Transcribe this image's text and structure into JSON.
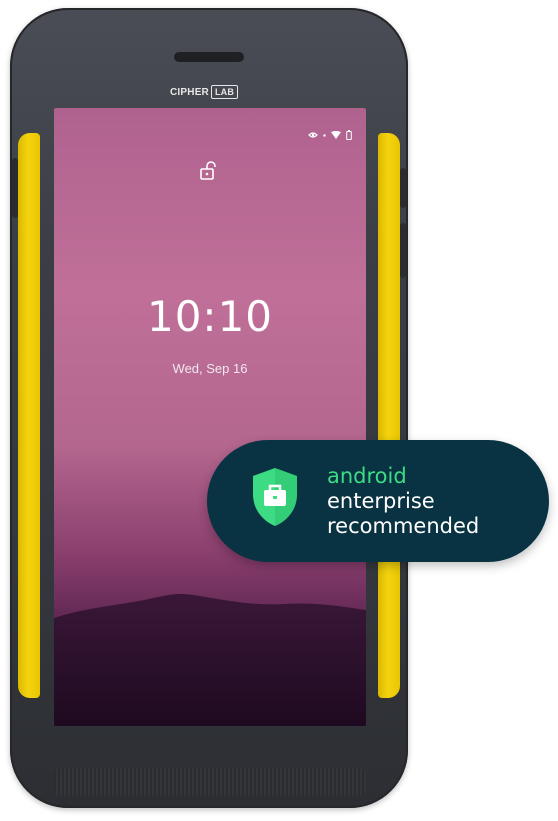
{
  "device": {
    "brand_left": "CIPHER",
    "brand_right": "LAB"
  },
  "lockscreen": {
    "time": "10:10",
    "date": "Wed, Sep 16",
    "status_icons": [
      "eye-icon",
      "dot-icon",
      "wifi-icon",
      "battery-icon"
    ],
    "lock_icon": "unlocked-padlock-icon"
  },
  "badge": {
    "line1": "android",
    "line2": "enterprise",
    "line3": "recommended",
    "icon": "shield-briefcase-icon",
    "colors": {
      "background": "#093342",
      "accent": "#3ddc84",
      "text": "#ffffff"
    }
  },
  "colors": {
    "body": "#3b3e45",
    "rail": "#f5d40f",
    "wallpaper_top": "#b0628f",
    "wallpaper_bottom": "#2a0f2b"
  }
}
